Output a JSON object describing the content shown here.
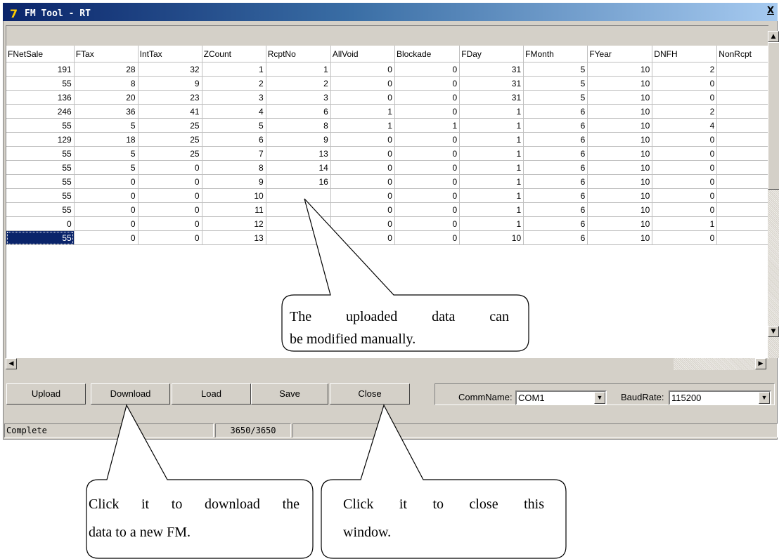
{
  "window": {
    "title": "FM Tool - RT",
    "close_symbol": "X"
  },
  "grid": {
    "columns": [
      "FNetSale",
      "FTax",
      "IntTax",
      "ZCount",
      "RcptNo",
      "AllVoid",
      "Blockade",
      "FDay",
      "FMonth",
      "FYear",
      "DNFH",
      "NonRcpt"
    ],
    "rows": [
      [
        "191",
        "28",
        "32",
        "1",
        "1",
        "0",
        "0",
        "31",
        "5",
        "10",
        "2"
      ],
      [
        "55",
        "8",
        "9",
        "2",
        "2",
        "0",
        "0",
        "31",
        "5",
        "10",
        "0"
      ],
      [
        "136",
        "20",
        "23",
        "3",
        "3",
        "0",
        "0",
        "31",
        "5",
        "10",
        "0"
      ],
      [
        "246",
        "36",
        "41",
        "4",
        "6",
        "1",
        "0",
        "1",
        "6",
        "10",
        "2"
      ],
      [
        "55",
        "5",
        "25",
        "5",
        "8",
        "1",
        "1",
        "1",
        "6",
        "10",
        "4"
      ],
      [
        "129",
        "18",
        "25",
        "6",
        "9",
        "0",
        "0",
        "1",
        "6",
        "10",
        "0"
      ],
      [
        "55",
        "5",
        "25",
        "7",
        "13",
        "0",
        "0",
        "1",
        "6",
        "10",
        "0"
      ],
      [
        "55",
        "5",
        "0",
        "8",
        "14",
        "0",
        "0",
        "1",
        "6",
        "10",
        "0"
      ],
      [
        "55",
        "0",
        "0",
        "9",
        "16",
        "0",
        "0",
        "1",
        "6",
        "10",
        "0"
      ],
      [
        "55",
        "0",
        "0",
        "10",
        "",
        "0",
        "0",
        "1",
        "6",
        "10",
        "0"
      ],
      [
        "55",
        "0",
        "0",
        "11",
        "",
        "0",
        "0",
        "1",
        "6",
        "10",
        "0"
      ],
      [
        "0",
        "0",
        "0",
        "12",
        "",
        "0",
        "0",
        "1",
        "6",
        "10",
        "1"
      ],
      [
        "55",
        "0",
        "0",
        "13",
        "",
        "0",
        "0",
        "10",
        "6",
        "10",
        "0"
      ]
    ],
    "selected_cell": "row 13, FNetSale"
  },
  "toolbar": {
    "upload": "Upload",
    "download": "Download",
    "load": "Load",
    "save": "Save",
    "close": "Close",
    "comm_label": "CommName:",
    "comm_value": "COM1",
    "baud_label": "BaudRate:",
    "baud_value": "115200"
  },
  "status": {
    "message": "Complete",
    "progress": "3650/3650"
  },
  "callouts": {
    "modify_line1": "The uploaded data can",
    "modify_line2": "be modified manually.",
    "download_line1": "Click it to download the",
    "download_line2": "data to a new FM.",
    "close_line1": "Click it to close this",
    "close_line2": "window."
  }
}
